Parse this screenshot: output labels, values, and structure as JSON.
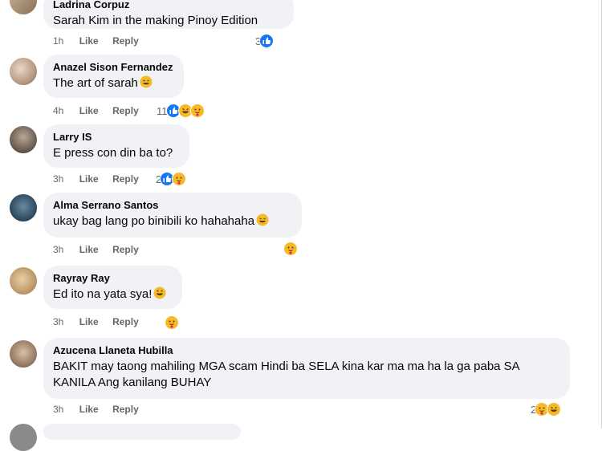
{
  "comments": [
    {
      "author": "Ladrina Corpuz",
      "text": "Sarah Kim in the making Pinoy Edition",
      "time": "1h",
      "like": "Like",
      "reply": "Reply",
      "reaction_count": "3",
      "reactions": [
        "like"
      ]
    },
    {
      "author": "Anazel Sison Fernandez",
      "text": "The art of sarah",
      "time": "4h",
      "like": "Like",
      "reply": "Reply",
      "reaction_count": "11",
      "reactions": [
        "like",
        "haha",
        "care"
      ]
    },
    {
      "author": "Larry IS",
      "text": "E press con din ba to?",
      "time": "3h",
      "like": "Like",
      "reply": "Reply",
      "reaction_count": "2",
      "reactions": [
        "like",
        "care"
      ]
    },
    {
      "author": "Alma Serrano Santos",
      "text": "ukay bag lang po binibili ko hahahaha",
      "time": "3h",
      "like": "Like",
      "reply": "Reply",
      "reaction_count": "",
      "reactions": [
        "care"
      ]
    },
    {
      "author": "Rayray Ray",
      "text": "Ed ito na yata sya!",
      "time": "3h",
      "like": "Like",
      "reply": "Reply",
      "reaction_count": "",
      "reactions": [
        "care"
      ]
    },
    {
      "author": "Azucena Llaneta Hubilla",
      "text": "BAKIT may taong mahiling MGA scam Hindi ba SELA kina kar ma ma ha la ga paba SA KANILA Ang kanilang BUHAY",
      "time": "3h",
      "like": "Like",
      "reply": "Reply",
      "reaction_count": "2",
      "reactions": [
        "care",
        "haha"
      ]
    }
  ],
  "colors": {
    "bubble": "#f0f2f5",
    "secondary_text": "#65676b",
    "like_blue": "#1877f2",
    "emoji_yellow": "#f7b928"
  }
}
